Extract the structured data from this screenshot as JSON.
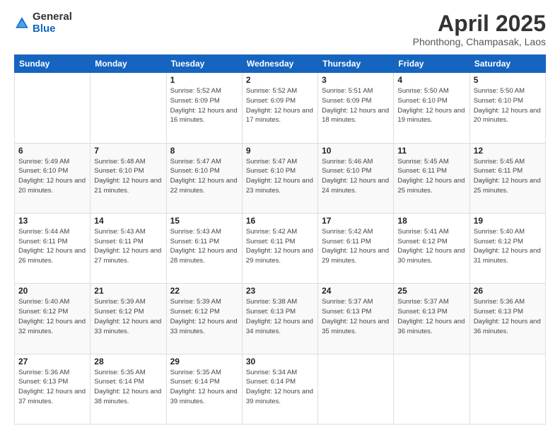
{
  "header": {
    "logo_general": "General",
    "logo_blue": "Blue",
    "title": "April 2025",
    "subtitle": "Phonthong, Champasak, Laos"
  },
  "weekdays": [
    "Sunday",
    "Monday",
    "Tuesday",
    "Wednesday",
    "Thursday",
    "Friday",
    "Saturday"
  ],
  "weeks": [
    [
      {
        "day": "",
        "info": ""
      },
      {
        "day": "",
        "info": ""
      },
      {
        "day": "1",
        "info": "Sunrise: 5:52 AM\nSunset: 6:09 PM\nDaylight: 12 hours and 16 minutes."
      },
      {
        "day": "2",
        "info": "Sunrise: 5:52 AM\nSunset: 6:09 PM\nDaylight: 12 hours and 17 minutes."
      },
      {
        "day": "3",
        "info": "Sunrise: 5:51 AM\nSunset: 6:09 PM\nDaylight: 12 hours and 18 minutes."
      },
      {
        "day": "4",
        "info": "Sunrise: 5:50 AM\nSunset: 6:10 PM\nDaylight: 12 hours and 19 minutes."
      },
      {
        "day": "5",
        "info": "Sunrise: 5:50 AM\nSunset: 6:10 PM\nDaylight: 12 hours and 20 minutes."
      }
    ],
    [
      {
        "day": "6",
        "info": "Sunrise: 5:49 AM\nSunset: 6:10 PM\nDaylight: 12 hours and 20 minutes."
      },
      {
        "day": "7",
        "info": "Sunrise: 5:48 AM\nSunset: 6:10 PM\nDaylight: 12 hours and 21 minutes."
      },
      {
        "day": "8",
        "info": "Sunrise: 5:47 AM\nSunset: 6:10 PM\nDaylight: 12 hours and 22 minutes."
      },
      {
        "day": "9",
        "info": "Sunrise: 5:47 AM\nSunset: 6:10 PM\nDaylight: 12 hours and 23 minutes."
      },
      {
        "day": "10",
        "info": "Sunrise: 5:46 AM\nSunset: 6:10 PM\nDaylight: 12 hours and 24 minutes."
      },
      {
        "day": "11",
        "info": "Sunrise: 5:45 AM\nSunset: 6:11 PM\nDaylight: 12 hours and 25 minutes."
      },
      {
        "day": "12",
        "info": "Sunrise: 5:45 AM\nSunset: 6:11 PM\nDaylight: 12 hours and 25 minutes."
      }
    ],
    [
      {
        "day": "13",
        "info": "Sunrise: 5:44 AM\nSunset: 6:11 PM\nDaylight: 12 hours and 26 minutes."
      },
      {
        "day": "14",
        "info": "Sunrise: 5:43 AM\nSunset: 6:11 PM\nDaylight: 12 hours and 27 minutes."
      },
      {
        "day": "15",
        "info": "Sunrise: 5:43 AM\nSunset: 6:11 PM\nDaylight: 12 hours and 28 minutes."
      },
      {
        "day": "16",
        "info": "Sunrise: 5:42 AM\nSunset: 6:11 PM\nDaylight: 12 hours and 29 minutes."
      },
      {
        "day": "17",
        "info": "Sunrise: 5:42 AM\nSunset: 6:11 PM\nDaylight: 12 hours and 29 minutes."
      },
      {
        "day": "18",
        "info": "Sunrise: 5:41 AM\nSunset: 6:12 PM\nDaylight: 12 hours and 30 minutes."
      },
      {
        "day": "19",
        "info": "Sunrise: 5:40 AM\nSunset: 6:12 PM\nDaylight: 12 hours and 31 minutes."
      }
    ],
    [
      {
        "day": "20",
        "info": "Sunrise: 5:40 AM\nSunset: 6:12 PM\nDaylight: 12 hours and 32 minutes."
      },
      {
        "day": "21",
        "info": "Sunrise: 5:39 AM\nSunset: 6:12 PM\nDaylight: 12 hours and 33 minutes."
      },
      {
        "day": "22",
        "info": "Sunrise: 5:39 AM\nSunset: 6:12 PM\nDaylight: 12 hours and 33 minutes."
      },
      {
        "day": "23",
        "info": "Sunrise: 5:38 AM\nSunset: 6:13 PM\nDaylight: 12 hours and 34 minutes."
      },
      {
        "day": "24",
        "info": "Sunrise: 5:37 AM\nSunset: 6:13 PM\nDaylight: 12 hours and 35 minutes."
      },
      {
        "day": "25",
        "info": "Sunrise: 5:37 AM\nSunset: 6:13 PM\nDaylight: 12 hours and 36 minutes."
      },
      {
        "day": "26",
        "info": "Sunrise: 5:36 AM\nSunset: 6:13 PM\nDaylight: 12 hours and 36 minutes."
      }
    ],
    [
      {
        "day": "27",
        "info": "Sunrise: 5:36 AM\nSunset: 6:13 PM\nDaylight: 12 hours and 37 minutes."
      },
      {
        "day": "28",
        "info": "Sunrise: 5:35 AM\nSunset: 6:14 PM\nDaylight: 12 hours and 38 minutes."
      },
      {
        "day": "29",
        "info": "Sunrise: 5:35 AM\nSunset: 6:14 PM\nDaylight: 12 hours and 39 minutes."
      },
      {
        "day": "30",
        "info": "Sunrise: 5:34 AM\nSunset: 6:14 PM\nDaylight: 12 hours and 39 minutes."
      },
      {
        "day": "",
        "info": ""
      },
      {
        "day": "",
        "info": ""
      },
      {
        "day": "",
        "info": ""
      }
    ]
  ]
}
